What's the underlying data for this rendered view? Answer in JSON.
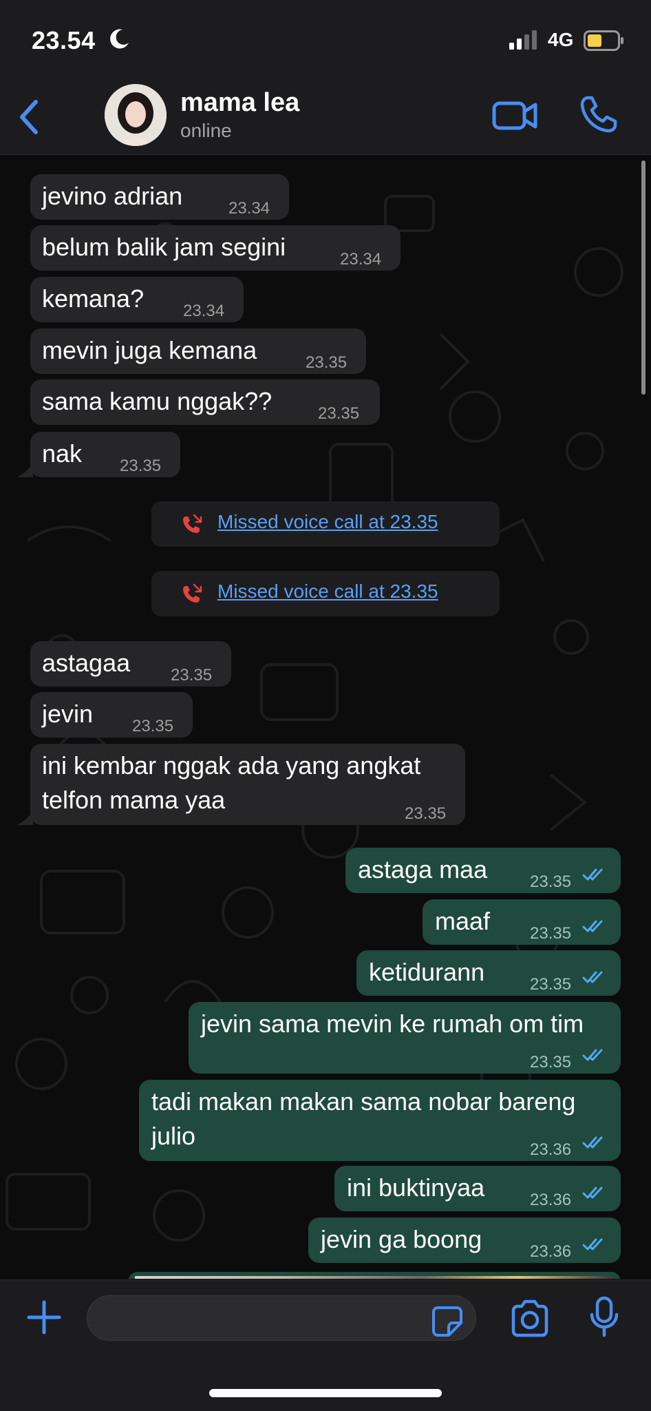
{
  "status_bar": {
    "time": "23.54",
    "network": "4G",
    "moon_icon": "moon-icon",
    "signal_icon": "signal-icon",
    "battery_icon": "battery-icon"
  },
  "header": {
    "contact_name": "mama lea",
    "contact_status": "online",
    "back_icon": "chevron-left-icon",
    "video_icon": "video-camera-icon",
    "call_icon": "phone-icon"
  },
  "messages": [
    {
      "dir": "in",
      "text": "jevino adrian",
      "time": "23.34"
    },
    {
      "dir": "in",
      "text": "belum balik jam segini",
      "time": "23.34"
    },
    {
      "dir": "in",
      "text": "kemana?",
      "time": "23.34"
    },
    {
      "dir": "in",
      "text": "mevin juga kemana",
      "time": "23.35"
    },
    {
      "dir": "in",
      "text": "sama kamu nggak??",
      "time": "23.35"
    },
    {
      "dir": "in",
      "text": "nak",
      "time": "23.35"
    },
    {
      "dir": "system",
      "text": "Missed voice call at 23.35"
    },
    {
      "dir": "system",
      "text": "Missed voice call at 23.35"
    },
    {
      "dir": "in",
      "text": "astagaa",
      "time": "23.35"
    },
    {
      "dir": "in",
      "text": "jevin",
      "time": "23.35"
    },
    {
      "dir": "in",
      "text": "ini kembar nggak ada yang angkat",
      "text2": "telfon mama yaa",
      "time": "23.35"
    },
    {
      "dir": "out",
      "text": "astaga maa",
      "time": "23.35",
      "status": "read"
    },
    {
      "dir": "out",
      "text": "maaf",
      "time": "23.35",
      "status": "read"
    },
    {
      "dir": "out",
      "text": "ketidurann",
      "time": "23.35",
      "status": "read"
    },
    {
      "dir": "out",
      "text": "jevin sama mevin ke rumah om tim",
      "time": "23.35",
      "status": "read"
    },
    {
      "dir": "out",
      "text": "tadi makan makan sama nobar bareng",
      "text2": "julio",
      "time": "23.36",
      "status": "read"
    },
    {
      "dir": "out",
      "text": "ini buktinyaa",
      "time": "23.36",
      "status": "read"
    },
    {
      "dir": "out",
      "text": "jevin ga boong",
      "time": "23.36",
      "status": "read"
    }
  ],
  "composer": {
    "placeholder": "",
    "plus_icon": "plus-icon",
    "sticker_icon": "sticker-icon",
    "camera_icon": "camera-icon",
    "mic_icon": "microphone-icon"
  },
  "colors": {
    "accent": "#4a8df0",
    "incoming_bubble": "#262628",
    "outgoing_bubble": "#1f4a3d",
    "missed_call_red": "#e8423f",
    "read_ticks": "#53a8f4"
  }
}
